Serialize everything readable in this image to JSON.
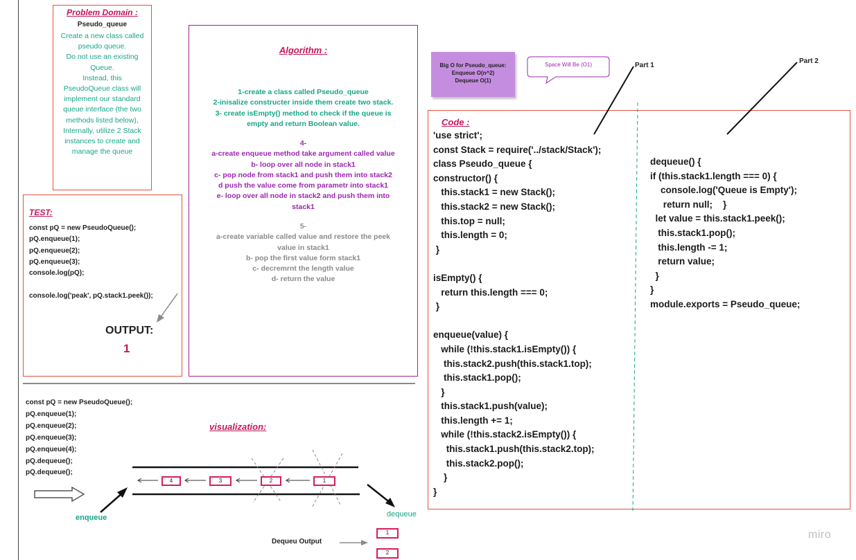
{
  "problem_domain": {
    "title": "Problem Domain :",
    "subtitle": "Pseudo_queue",
    "lines": [
      "Create a new class called",
      "pseudo queue.",
      "Do not use an existing",
      "Queue.",
      "Instead, this",
      "PseudoQueue class will",
      "implement our standard",
      "queue interface (the two",
      "methods listed below),",
      "Internally, utilize 2 Stack",
      "instances to create and",
      "manage the queue"
    ]
  },
  "algorithm": {
    "title": "Algorithm :",
    "step1": [
      "1-create a class called Pseudo_queue",
      "2-inisalize constructer inside them create two stack.",
      "3- create isEmpty() method to check if the queue is",
      "empty and return Boolean value."
    ],
    "step2": [
      "4-",
      "a-create enqueue method take argument called value",
      "b- loop over all node in stack1",
      "c- pop node from stack1 and push them into stack2",
      "d push the value come from parametr into stack1",
      "e- loop over all node in stack2 and push them into",
      "stack1"
    ],
    "step3": [
      "5-",
      "a-create variable called value and restore the peek",
      "value in stack1",
      "b- pop the first value form stack1",
      "c- decremrnt the length value",
      "d- return the value"
    ]
  },
  "test": {
    "title": "TEST:",
    "code": "const pQ = new PseudoQueue();\npQ.enqueue(1);\npQ.enqueue(2);\npQ.enqueue(3);\nconsole.log(pQ);\n\nconsole.log('peak', pQ.stack1.peek());",
    "output_label": "OUTPUT:",
    "output_value": "1"
  },
  "big_o": [
    "Big O for Pseudo_queue:",
    "Enqueue O(n^2)",
    "Dequeue O(1)"
  ],
  "space_note": "Space Will Be (O1)",
  "part1_label": "Part 1",
  "part2_label": "Part 2",
  "code": {
    "title": "Code :",
    "part1": "'use strict';\nconst Stack = require('../stack/Stack');\nclass Pseudo_queue {\nconstructor() {\n   this.stack1 = new Stack();\n   this.stack2 = new Stack();\n   this.top = null;\n   this.length = 0;\n }\n\nisEmpty() {\n   return this.length === 0;\n }\n\nenqueue(value) {\n   while (!this.stack1.isEmpty()) {\n    this.stack2.push(this.stack1.top);\n    this.stack1.pop();\n   }\n   this.stack1.push(value);\n   this.length += 1;\n   while (!this.stack2.isEmpty()) {\n     this.stack1.push(this.stack2.top);\n     this.stack2.pop();\n    }\n}",
    "part2": "dequeue() {\nif (this.stack1.length === 0) {\n    console.log('Queue is Empty');\n     return null;    }\n  let value = this.stack1.peek();\n   this.stack1.pop();\n   this.length -= 1;\n   return value;\n  }\n}\nmodule.exports = Pseudo_queue;"
  },
  "visualization": {
    "code": "const pQ = new PseudoQueue();\npQ.enqueue(1);\npQ.enqueue(2);\npQ.enqueue(3);\npQ.enqueue(4);\npQ.dequeue();\npQ.dequeue();",
    "title": "visualization:",
    "nodes": [
      "4",
      "3",
      "2",
      "1"
    ],
    "enqueue_label": "enqueue",
    "dequeue_label": "dequeue",
    "dequeue_output_label": "Dequeu Output",
    "output_nodes": [
      "1",
      "2"
    ]
  },
  "brand": "miro",
  "colors": {
    "title_pink": "#c2185b",
    "teal": "#17a589",
    "purple": "#9c27b0",
    "box_border_orange": "#e0523f",
    "algorithm_border": "#a2248f",
    "sticky": "#c58de0",
    "node_border": "#d81b60"
  }
}
